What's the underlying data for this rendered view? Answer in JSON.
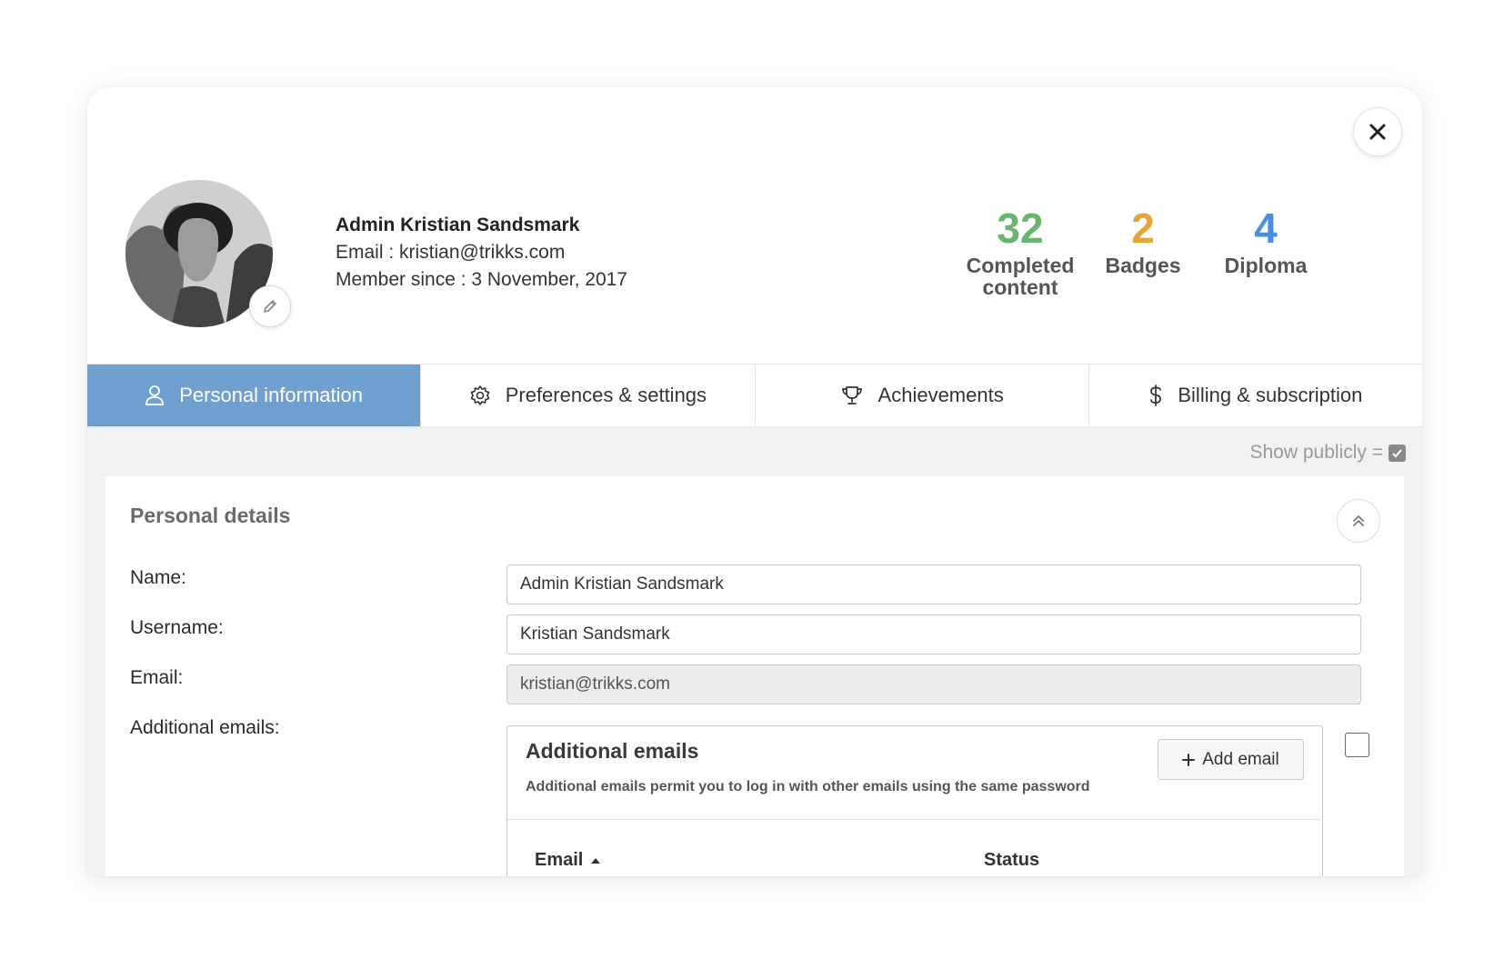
{
  "profile": {
    "name": "Admin Kristian Sandsmark",
    "email_line": "Email : kristian@trikks.com",
    "member_line": "Member since : 3 November, 2017"
  },
  "stats": [
    {
      "value": "32",
      "label": "Completed content",
      "color": "#6ab56e"
    },
    {
      "value": "2",
      "label": "Badges",
      "color": "#e8a43a"
    },
    {
      "value": "4",
      "label": "Diploma",
      "color": "#4a8fe0"
    }
  ],
  "tabs": [
    {
      "label": "Personal information",
      "icon": "user-icon",
      "active": true
    },
    {
      "label": "Preferences & settings",
      "icon": "gear-icon",
      "active": false
    },
    {
      "label": "Achievements",
      "icon": "trophy-icon",
      "active": false
    },
    {
      "label": "Billing & subscription",
      "icon": "dollar-icon",
      "active": false
    }
  ],
  "show_publicly": "Show publicly =",
  "personal_details": {
    "title": "Personal details",
    "fields": {
      "name": {
        "label": "Name:",
        "value": "Admin Kristian Sandsmark"
      },
      "username": {
        "label": "Username:",
        "value": "Kristian Sandsmark"
      },
      "email": {
        "label": "Email:",
        "value": "kristian@trikks.com"
      },
      "additional_emails": {
        "label": "Additional emails:"
      }
    }
  },
  "additional_emails": {
    "title": "Additional emails",
    "description": "Additional emails permit you to log in with other emails using the same password",
    "add_button": "Add email",
    "columns": {
      "email": "Email",
      "status": "Status"
    }
  },
  "colors": {
    "active_tab": "#6fa0d0",
    "completed": "#6ab56e",
    "badges": "#e8a43a",
    "diploma": "#4a8fe0"
  }
}
